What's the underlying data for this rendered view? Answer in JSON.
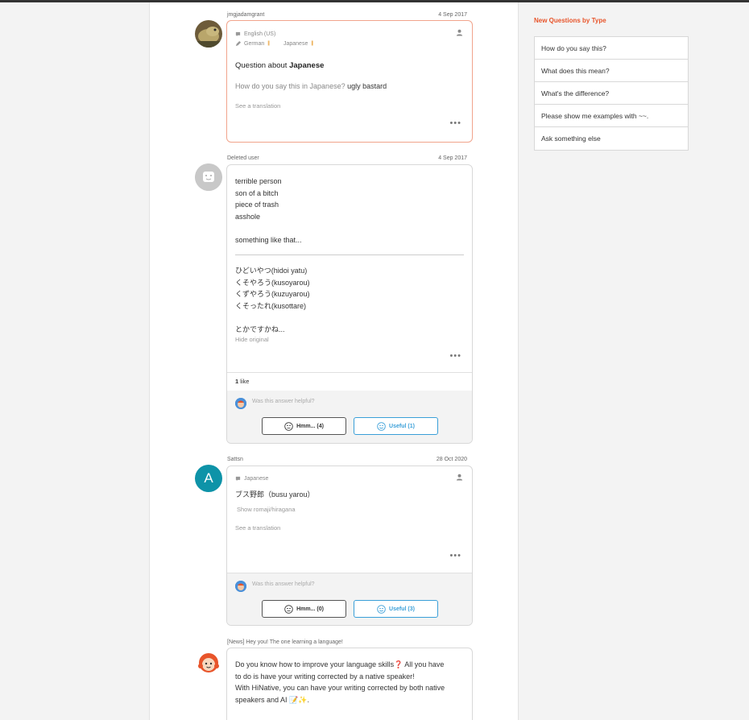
{
  "question": {
    "username": "jmgjadamgrant",
    "date": "4 Sep 2017",
    "native_lang": "English (US)",
    "learning_1": "German",
    "learning_2": "Japanese",
    "title_prefix": "Question about ",
    "title_lang": "Japanese",
    "body_prefix": "How do you say this in Japanese? ",
    "body_phrase": "ugly bastard",
    "translation_link": "See a translation",
    "more": "•••"
  },
  "answer1": {
    "username": "Deleted user",
    "date": "4 Sep 2017",
    "lines_en": [
      "terrible person",
      "son of a bitch",
      "piece of trash",
      "asshole"
    ],
    "closing_en": "something like that...",
    "lines_jp": [
      "ひどいやつ(hidoi yatu)",
      "くそやろう(kusoyarou)",
      "くずやろう(kuzuyarou)",
      "くそったれ(kusottare)"
    ],
    "closing_jp": "とかですかね...",
    "hide_original": "Hide original",
    "more": "•••",
    "like_count": "1",
    "like_label": "like",
    "helpful_q": "Was this answer helpful?",
    "hmm_label": "Hmm... (4)",
    "useful_label": "Useful (1)"
  },
  "answer2": {
    "username": "Sattsn",
    "date": "28 Oct 2020",
    "avatar_letter": "A",
    "native_lang": "Japanese",
    "text": "ブス野郎（busu yarou）",
    "romaji_link": "Show romaji/hiragana",
    "translation_link": "See a translation",
    "more": "•••",
    "helpful_q": "Was this answer helpful?",
    "hmm_label": "Hmm... (0)",
    "useful_label": "Useful (3)"
  },
  "news": {
    "header": "[News] Hey you! The one learning a language!",
    "lines": [
      "Do you know how to improve your language skills❓ All you have",
      "to do is have your writing corrected by a native speaker!",
      "With HiNative, you can have your writing corrected by both native",
      "speakers and AI 📝✨."
    ]
  },
  "sidebar": {
    "title": "New Questions by Type",
    "items": [
      "How do you say this?",
      "What does this mean?",
      "What's the difference?",
      "Please show me examples with ~~.",
      "Ask something else"
    ]
  },
  "colors": {
    "accent": "#e8542a",
    "useful": "#3a9fd8",
    "avatar_teal": "#0e93a8"
  }
}
